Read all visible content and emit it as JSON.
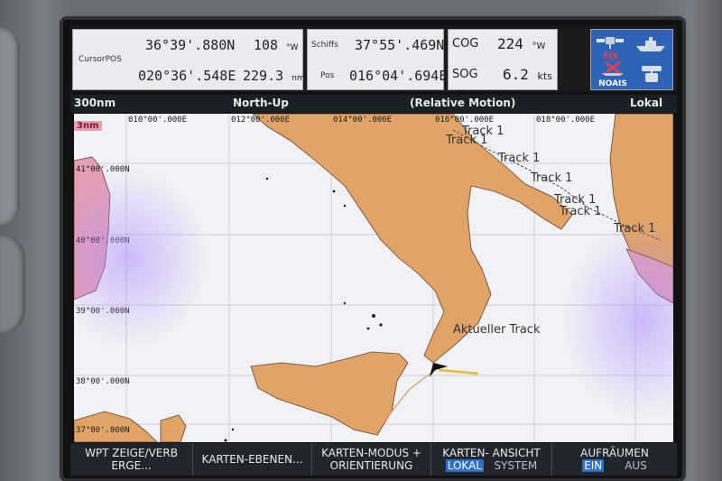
{
  "cursor": {
    "label": "CursorPOS",
    "lat": "36°39'.880N",
    "lon": "020°36'.548E",
    "bearing": "108",
    "bearing_unit": "°W",
    "distance": "229.3",
    "distance_unit": "nm"
  },
  "ship": {
    "label_top": "Schiffs",
    "label_bottom": "Pos",
    "lat": "37°55'.469N",
    "lon": "016°04'.694E"
  },
  "cog": {
    "label": "COG",
    "value": "224",
    "unit": "°W"
  },
  "sog": {
    "label": "SOG",
    "value": "6.2",
    "unit": "kts"
  },
  "status": {
    "fix_label": "FIX",
    "noais_label": "NOAIS"
  },
  "header": {
    "range": "300nm",
    "orientation": "North-Up",
    "motion": "(Relative Motion)",
    "mode": "Lokal"
  },
  "map": {
    "range_badge": "3nm",
    "lat_labels": [
      "41°00'.000N",
      "40°00'.000N",
      "39°00'.000N",
      "38°00'.000N",
      "37°00'.000N"
    ],
    "lon_labels": [
      "010°00'.000E",
      "012°00'.000E",
      "014°00'.000E",
      "016°00'.000E",
      "018°00'.000E"
    ],
    "track_labels": [
      "Track 1",
      "Track 1",
      "Track 1",
      "Track 1",
      "Track 1",
      "Track 1",
      "Track 1"
    ],
    "current_track_label": "Aktueller Track",
    "colors": {
      "sea": "#f1f2f5",
      "land": "#e0a466",
      "foreign": "#e3a0b4",
      "grid": "#c9ccd1"
    }
  },
  "softkeys": [
    {
      "line1": "WPT ZEIGE/VERB",
      "line2": "ERGE..."
    },
    {
      "line1": "KARTEN-EBENEN...",
      "line2": ""
    },
    {
      "line1": "KARTEN-MODUS +",
      "line2": "ORIENTIERUNG"
    },
    {
      "line1": "KARTEN- ANSICHT",
      "opt_a": "LOKAL",
      "opt_b": "SYSTEM"
    },
    {
      "line1": "AUFRÄUMEN",
      "opt_a": "EIN",
      "opt_b": "AUS"
    }
  ]
}
